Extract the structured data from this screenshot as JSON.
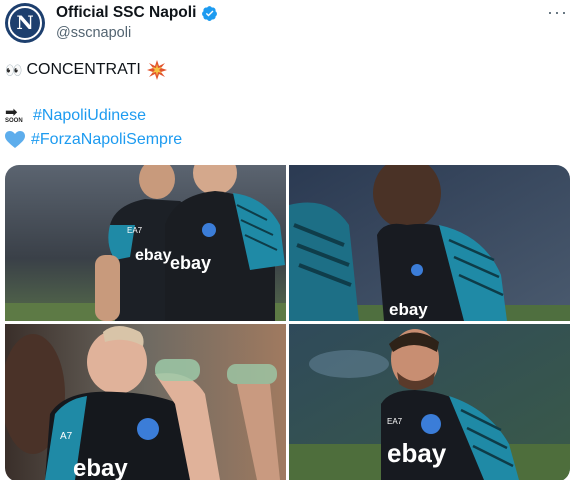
{
  "account": {
    "display_name": "Official SSC Napoli",
    "handle": "@sscnapoli",
    "avatar_letter": "N",
    "brand_color": "#1d3f6e",
    "verified_color": "#1d9bf0"
  },
  "tweet": {
    "line1_text": "CONCENTRATI",
    "line1_emojis": [
      "eyes-emoji",
      "collision-emoji"
    ],
    "soon_label": "SOON",
    "hashtag1": "#NapoliUdinese",
    "hashtag2": "#ForzaNapoliSempre",
    "heart_emoji": "blue-heart-emoji"
  },
  "media": {
    "photos": [
      {
        "sponsor": "ebay",
        "brand": "EA7",
        "description_icon": "players-warmup-photo"
      },
      {
        "sponsor": "ebay",
        "brand": "",
        "description_icon": "player-closeup-photo"
      },
      {
        "sponsor": "ebay",
        "brand": "EA7",
        "description_icon": "player-drinking-photo"
      },
      {
        "sponsor": "ebay",
        "brand": "EA7",
        "description_icon": "player-portrait-photo"
      }
    ]
  },
  "colors": {
    "hashtag": "#1d9bf0",
    "shirt_dark": "#1b1e24",
    "shirt_teal": "#1f8aa6"
  }
}
